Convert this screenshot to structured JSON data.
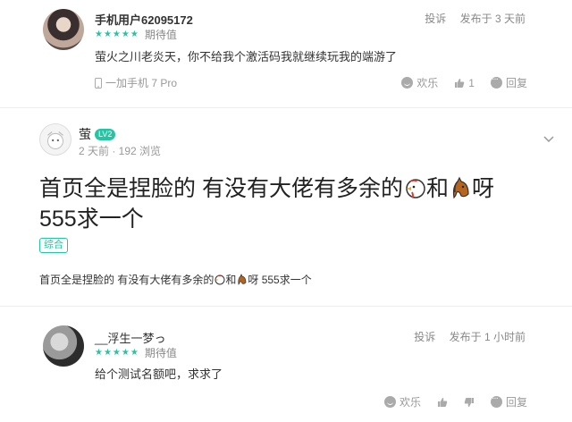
{
  "comment1": {
    "username": "手机用户62095172",
    "stars": "★★★★★",
    "rating_label": "期待值",
    "report": "投诉",
    "posted": "发布于 3 天前",
    "text": "萤火之川老炎天，你不给我个激活码我就继续玩我的端游了",
    "device": "一加手机 7 Pro",
    "actions": {
      "happy": "欢乐",
      "like_count": "1",
      "reply": "回复"
    }
  },
  "post": {
    "author": "萤",
    "level": "LV2",
    "meta": "2 天前 · 192 浏览",
    "title_part1": "首页全是捏脸的 有没有大佬有多余的",
    "title_and": "和",
    "title_part2": "呀",
    "title_line2": "555求一个",
    "tag": "综合",
    "body_part1": "首页全是捏脸的 有没有大佬有多余的",
    "body_and": "和",
    "body_part2": "呀 555求一个"
  },
  "comment2": {
    "username": "__浮生一梦っ",
    "stars": "★★★★★",
    "rating_label": "期待值",
    "report": "投诉",
    "posted": "发布于 1 小时前",
    "text": "给个测试名额吧，求求了",
    "actions": {
      "happy": "欢乐",
      "reply": "回复"
    }
  },
  "colors": {
    "accent": "#25c4a4",
    "muted": "#999999",
    "text": "#333333"
  },
  "icons": [
    "phone-icon",
    "smile-icon",
    "thumb-up-icon",
    "reply-icon",
    "chevron-down-icon",
    "chicken-emoji-icon",
    "horse-emoji-icon"
  ]
}
